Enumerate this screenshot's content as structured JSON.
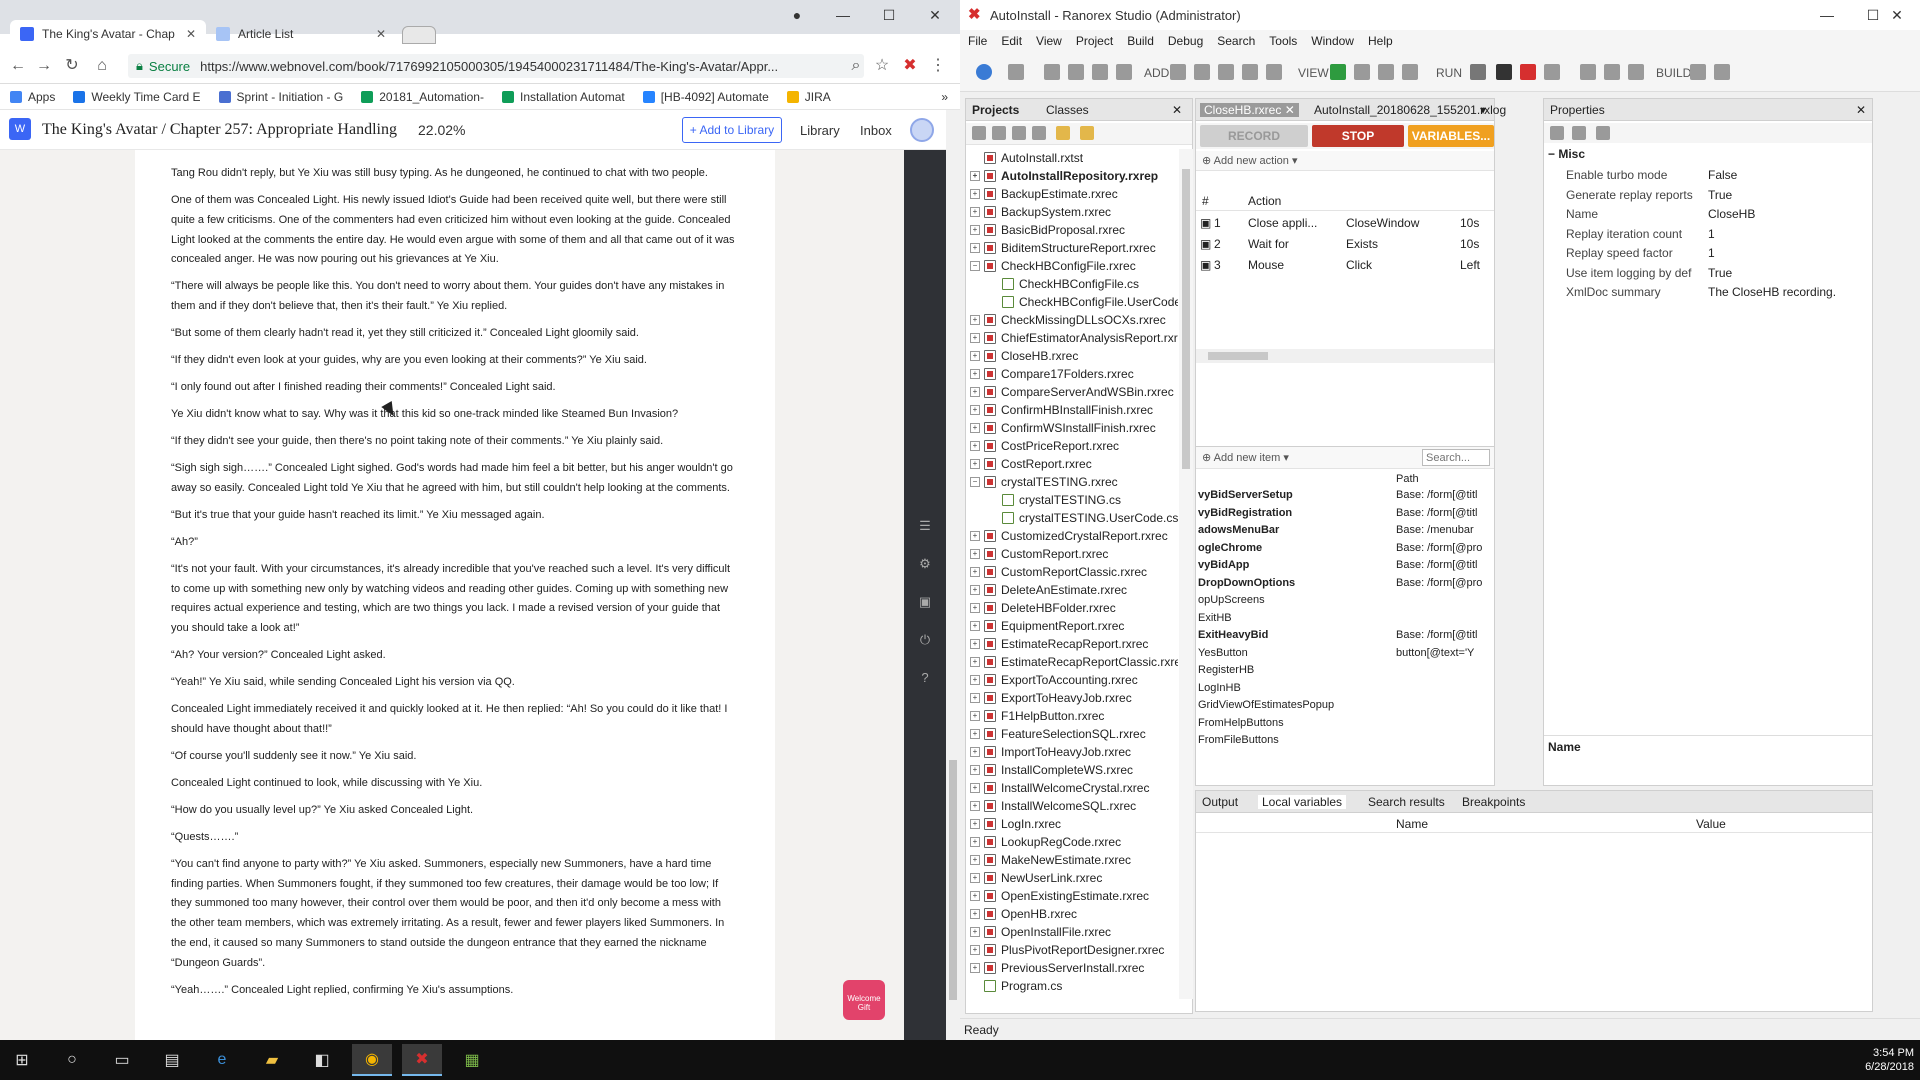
{
  "chrome": {
    "tabs": [
      {
        "label": "The King's Avatar - Chap",
        "color": "#3b66f5"
      },
      {
        "label": "Article List",
        "color": "#3b66f5"
      }
    ],
    "secure_label": "Secure",
    "url": "https://www.webnovel.com/book/7176992105000305/19454000231711484/The-King's-Avatar/Appr...",
    "bookmarks": [
      {
        "label": "Apps",
        "color": "#4285f4"
      },
      {
        "label": "Weekly Time Card E",
        "color": "#1a73e8"
      },
      {
        "label": "Sprint - Initiation - G",
        "color": "#4a6fd1"
      },
      {
        "label": "20181_Automation-",
        "color": "#0f9d58"
      },
      {
        "label": "Installation Automat",
        "color": "#0f9d58"
      },
      {
        "label": "[HB-4092] Automate",
        "color": "#2684ff"
      },
      {
        "label": "JIRA",
        "color": "#f4b400"
      }
    ]
  },
  "site": {
    "logo": "W",
    "title": "The King's Avatar / Chapter 257: Appropriate Handling",
    "progress": "22.02%",
    "add_to_library": "+ Add to Library",
    "library": "Library",
    "inbox": "Inbox",
    "welcome_gift": "Welcome Gift"
  },
  "chapter_paragraphs": [
    "Tang Rou didn't reply, but Ye Xiu was still busy typing. As he dungeoned, he continued to chat with two people.",
    "One of them was Concealed Light. His newly issued Idiot's Guide had been received quite well, but there were still quite a few criticisms. One of the commenters had even criticized him without even looking at the guide. Concealed Light looked at the comments the entire day. He would even argue with some of them and all that came out of it was concealed anger. He was now pouring out his grievances at Ye Xiu.",
    "“There will always be people like this. You don't need to worry about them. Your guides don't have any mistakes in them and if they don't believe that, then it's their fault.” Ye Xiu replied.",
    "“But some of them clearly hadn't read it, yet they still criticized it.” Concealed Light gloomily said.",
    "“If they didn't even look at your guides, why are you even looking at their comments?” Ye Xiu said.",
    "“I only found out after I finished reading their comments!” Concealed Light said.",
    "Ye Xiu didn't know what to say. Why was it that this kid so one-track minded like Steamed Bun Invasion?",
    "“If they didn't see your guide, then there's no point taking note of their comments.” Ye Xiu plainly said.",
    "“Sigh sigh sigh…….” Concealed Light sighed. God's words had made him feel a bit better, but his anger wouldn't go away so easily. Concealed Light told Ye Xiu that he agreed with him, but still couldn't help looking at the comments.",
    "“But it's true that your guide hasn't reached its limit.” Ye Xiu messaged again.",
    "“Ah?”",
    "“It's not your fault. With your circumstances, it's already incredible that you've reached such a level. It's very difficult to come up with something new only by watching videos and reading other guides. Coming up with something new requires actual experience and testing, which are two things you lack. I made a revised version of your guide that you should take a look at!”",
    "“Ah? Your version?” Concealed Light asked.",
    "“Yeah!” Ye Xiu said, while sending Concealed Light his version via QQ.",
    "Concealed Light immediately received it and quickly looked at it. He then replied: “Ah! So you could do it like that! I should have thought about that!!”",
    "“Of course you'll suddenly see it now.” Ye Xiu said.",
    "Concealed Light continued to look, while discussing with Ye Xiu.",
    "“How do you usually level up?” Ye Xiu asked Concealed Light.",
    "“Quests…….”",
    "“You can't find anyone to party with?” Ye Xiu asked. Summoners, especially new Summoners, have a hard time finding parties. When Summoners fought, if they summoned too few creatures, their damage would be too low; If they summoned too many however, their control over them would be poor, and then it'd only become a mess with the other team members, which was extremely irritating. As a result, fewer and fewer players liked Summoners. In the end, it caused so many Summoners to stand outside the dungeon entrance that they earned the nickname “Dungeon Guards”.",
    "“Yeah…….” Concealed Light replied, confirming Ye Xiu's assumptions."
  ],
  "ranorex": {
    "title": "AutoInstall - Ranorex Studio (Administrator)",
    "menu": [
      "File",
      "Edit",
      "View",
      "Project",
      "Build",
      "Debug",
      "Search",
      "Tools",
      "Window",
      "Help"
    ],
    "toolbar": {
      "add": "ADD",
      "view": "VIEW",
      "run": "RUN",
      "build": "BUILD"
    },
    "projects_tabs": [
      "Projects",
      "Classes"
    ],
    "tree": [
      {
        "label": "AutoInstall.rxtst",
        "kind": "rx",
        "exp": "",
        "indent": 0,
        "bold": false
      },
      {
        "label": "AutoInstallRepository.rxrep",
        "kind": "rx",
        "exp": "+",
        "indent": 0,
        "bold": true
      },
      {
        "label": "BackupEstimate.rxrec",
        "kind": "rx",
        "exp": "+",
        "indent": 0,
        "bold": false
      },
      {
        "label": "BackupSystem.rxrec",
        "kind": "rx",
        "exp": "+",
        "indent": 0,
        "bold": false
      },
      {
        "label": "BasicBidProposal.rxrec",
        "kind": "rx",
        "exp": "+",
        "indent": 0,
        "bold": false
      },
      {
        "label": "BiditemStructureReport.rxrec",
        "kind": "rx",
        "exp": "+",
        "indent": 0,
        "bold": false
      },
      {
        "label": "CheckHBConfigFile.rxrec",
        "kind": "rx",
        "exp": "−",
        "indent": 0,
        "bold": false
      },
      {
        "label": "CheckHBConfigFile.cs",
        "kind": "cs",
        "exp": "",
        "indent": 1,
        "bold": false
      },
      {
        "label": "CheckHBConfigFile.UserCode.cs",
        "kind": "cs",
        "exp": "",
        "indent": 1,
        "bold": false
      },
      {
        "label": "CheckMissingDLLsOCXs.rxrec",
        "kind": "rx",
        "exp": "+",
        "indent": 0,
        "bold": false
      },
      {
        "label": "ChiefEstimatorAnalysisReport.rxrec",
        "kind": "rx",
        "exp": "+",
        "indent": 0,
        "bold": false
      },
      {
        "label": "CloseHB.rxrec",
        "kind": "rx",
        "exp": "+",
        "indent": 0,
        "bold": false
      },
      {
        "label": "Compare17Folders.rxrec",
        "kind": "rx",
        "exp": "+",
        "indent": 0,
        "bold": false
      },
      {
        "label": "CompareServerAndWSBin.rxrec",
        "kind": "rx",
        "exp": "+",
        "indent": 0,
        "bold": false
      },
      {
        "label": "ConfirmHBInstallFinish.rxrec",
        "kind": "rx",
        "exp": "+",
        "indent": 0,
        "bold": false
      },
      {
        "label": "ConfirmWSInstallFinish.rxrec",
        "kind": "rx",
        "exp": "+",
        "indent": 0,
        "bold": false
      },
      {
        "label": "CostPriceReport.rxrec",
        "kind": "rx",
        "exp": "+",
        "indent": 0,
        "bold": false
      },
      {
        "label": "CostReport.rxrec",
        "kind": "rx",
        "exp": "+",
        "indent": 0,
        "bold": false
      },
      {
        "label": "crystalTESTING.rxrec",
        "kind": "rx",
        "exp": "−",
        "indent": 0,
        "bold": false
      },
      {
        "label": "crystalTESTING.cs",
        "kind": "cs",
        "exp": "",
        "indent": 1,
        "bold": false
      },
      {
        "label": "crystalTESTING.UserCode.cs",
        "kind": "cs",
        "exp": "",
        "indent": 1,
        "bold": false
      },
      {
        "label": "CustomizedCrystalReport.rxrec",
        "kind": "rx",
        "exp": "+",
        "indent": 0,
        "bold": false
      },
      {
        "label": "CustomReport.rxrec",
        "kind": "rx",
        "exp": "+",
        "indent": 0,
        "bold": false
      },
      {
        "label": "CustomReportClassic.rxrec",
        "kind": "rx",
        "exp": "+",
        "indent": 0,
        "bold": false
      },
      {
        "label": "DeleteAnEstimate.rxrec",
        "kind": "rx",
        "exp": "+",
        "indent": 0,
        "bold": false
      },
      {
        "label": "DeleteHBFolder.rxrec",
        "kind": "rx",
        "exp": "+",
        "indent": 0,
        "bold": false
      },
      {
        "label": "EquipmentReport.rxrec",
        "kind": "rx",
        "exp": "+",
        "indent": 0,
        "bold": false
      },
      {
        "label": "EstimateRecapReport.rxrec",
        "kind": "rx",
        "exp": "+",
        "indent": 0,
        "bold": false
      },
      {
        "label": "EstimateRecapReportClassic.rxrec",
        "kind": "rx",
        "exp": "+",
        "indent": 0,
        "bold": false
      },
      {
        "label": "ExportToAccounting.rxrec",
        "kind": "rx",
        "exp": "+",
        "indent": 0,
        "bold": false
      },
      {
        "label": "ExportToHeavyJob.rxrec",
        "kind": "rx",
        "exp": "+",
        "indent": 0,
        "bold": false
      },
      {
        "label": "F1HelpButton.rxrec",
        "kind": "rx",
        "exp": "+",
        "indent": 0,
        "bold": false
      },
      {
        "label": "FeatureSelectionSQL.rxrec",
        "kind": "rx",
        "exp": "+",
        "indent": 0,
        "bold": false
      },
      {
        "label": "ImportToHeavyJob.rxrec",
        "kind": "rx",
        "exp": "+",
        "indent": 0,
        "bold": false
      },
      {
        "label": "InstallCompleteWS.rxrec",
        "kind": "rx",
        "exp": "+",
        "indent": 0,
        "bold": false
      },
      {
        "label": "InstallWelcomeCrystal.rxrec",
        "kind": "rx",
        "exp": "+",
        "indent": 0,
        "bold": false
      },
      {
        "label": "InstallWelcomeSQL.rxrec",
        "kind": "rx",
        "exp": "+",
        "indent": 0,
        "bold": false
      },
      {
        "label": "LogIn.rxrec",
        "kind": "rx",
        "exp": "+",
        "indent": 0,
        "bold": false
      },
      {
        "label": "LookupRegCode.rxrec",
        "kind": "rx",
        "exp": "+",
        "indent": 0,
        "bold": false
      },
      {
        "label": "MakeNewEstimate.rxrec",
        "kind": "rx",
        "exp": "+",
        "indent": 0,
        "bold": false
      },
      {
        "label": "NewUserLink.rxrec",
        "kind": "rx",
        "exp": "+",
        "indent": 0,
        "bold": false
      },
      {
        "label": "OpenExistingEstimate.rxrec",
        "kind": "rx",
        "exp": "+",
        "indent": 0,
        "bold": false
      },
      {
        "label": "OpenHB.rxrec",
        "kind": "rx",
        "exp": "+",
        "indent": 0,
        "bold": false
      },
      {
        "label": "OpenInstallFile.rxrec",
        "kind": "rx",
        "exp": "+",
        "indent": 0,
        "bold": false
      },
      {
        "label": "PlusPivotReportDesigner.rxrec",
        "kind": "rx",
        "exp": "+",
        "indent": 0,
        "bold": false
      },
      {
        "label": "PreviousServerInstall.rxrec",
        "kind": "rx",
        "exp": "+",
        "indent": 0,
        "bold": false
      },
      {
        "label": "Program.cs",
        "kind": "cs",
        "exp": "",
        "indent": 0,
        "bold": false
      }
    ],
    "editor_tabs": [
      "CloseHB.rxrec",
      "AutoInstall_20180628_155201.rxlog"
    ],
    "record_label": "RECORD",
    "stop_label": "STOP",
    "variables_label": "VARIABLES...",
    "add_action_label": "Add new action",
    "action_headers": [
      "#",
      "Action"
    ],
    "actions": [
      {
        "num": "1",
        "action": "Close appli...",
        "target": "CloseWindow",
        "value": "10s"
      },
      {
        "num": "2",
        "action": "Wait for",
        "target": "Exists",
        "value": "10s"
      },
      {
        "num": "3",
        "action": "Mouse",
        "target": "Click",
        "value": "Left"
      }
    ],
    "add_item_label": "Add new item",
    "repo_search_placeholder": "Search...",
    "repo_path_header": "Path",
    "repo_items": [
      {
        "name": "vyBidServerSetup",
        "path": "Base: /form[@titl",
        "bold": true
      },
      {
        "name": "vyBidRegistration",
        "path": "Base: /form[@titl",
        "bold": true
      },
      {
        "name": "adowsMenuBar",
        "path": "Base: /menubar",
        "bold": true
      },
      {
        "name": "ogleChrome",
        "path": "Base: /form[@pro",
        "bold": true
      },
      {
        "name": "vyBidApp",
        "path": "Base: /form[@titl",
        "bold": true
      },
      {
        "name": "DropDownOptions",
        "path": "Base: /form[@pro",
        "bold": true
      },
      {
        "name": "opUpScreens",
        "path": "",
        "bold": false
      },
      {
        "name": "ExitHB",
        "path": "",
        "bold": false
      },
      {
        "name": "ExitHeavyBid",
        "path": "Base: /form[@titl",
        "bold": true
      },
      {
        "name": "YesButton",
        "path": "button[@text='Y",
        "bold": false
      },
      {
        "name": "RegisterHB",
        "path": "",
        "bold": false
      },
      {
        "name": "LogInHB",
        "path": "",
        "bold": false
      },
      {
        "name": "GridViewOfEstimatesPopup",
        "path": "",
        "bold": false
      },
      {
        "name": "FromHelpButtons",
        "path": "",
        "bold": false
      },
      {
        "name": "FromFileButtons",
        "path": "",
        "bold": false
      }
    ],
    "properties_title": "Properties",
    "props_section": "Misc",
    "properties": [
      {
        "key": "Enable turbo mode",
        "value": "False"
      },
      {
        "key": "Generate replay reports",
        "value": "True"
      },
      {
        "key": "Name",
        "value": "CloseHB"
      },
      {
        "key": "Replay iteration count",
        "value": "1"
      },
      {
        "key": "Replay speed factor",
        "value": "1"
      },
      {
        "key": "Use item logging by def",
        "value": "True"
      },
      {
        "key": "XmlDoc summary",
        "value": "The CloseHB recording."
      }
    ],
    "props_footer": "Name",
    "output_tabs": [
      "Output",
      "Local variables",
      "Search results",
      "Breakpoints"
    ],
    "output_headers": [
      "Name",
      "Value"
    ],
    "status": "Ready"
  },
  "taskbar": {
    "time": "3:54 PM",
    "date": "6/28/2018"
  }
}
